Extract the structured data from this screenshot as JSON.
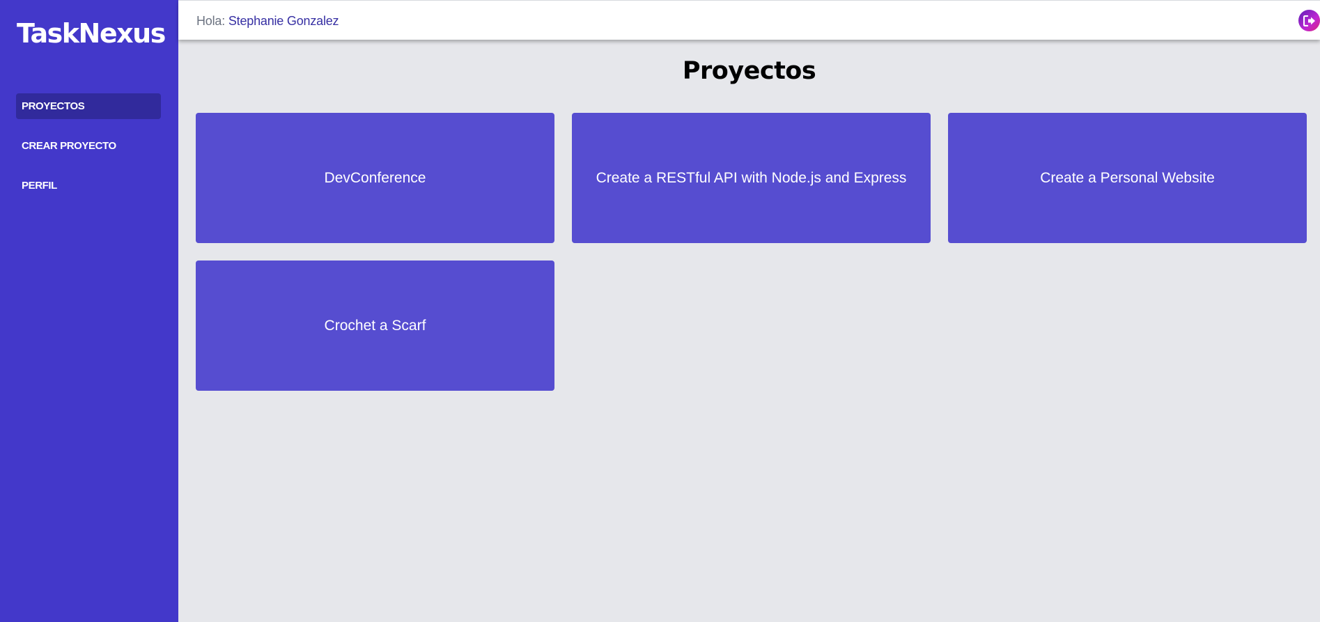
{
  "app": {
    "brand": "TaskNexus"
  },
  "sidebar": {
    "items": [
      {
        "label": "PROYECTOS",
        "active": true
      },
      {
        "label": "CREAR PROYECTO",
        "active": false
      },
      {
        "label": "PERFIL",
        "active": false
      }
    ]
  },
  "header": {
    "greeting": "Hola:",
    "user_name": "Stephanie Gonzalez",
    "logout_icon": "logout-icon"
  },
  "main": {
    "title": "Proyectos",
    "projects": [
      {
        "name": "DevConference"
      },
      {
        "name": "Create a RESTful API with Node.js and Express"
      },
      {
        "name": "Create a Personal Website"
      },
      {
        "name": "Crochet a Scarf"
      }
    ]
  },
  "colors": {
    "sidebar": "#4338ca",
    "card": "#564dd0",
    "background": "#e6e7eb",
    "user_name": "#3730a3"
  }
}
